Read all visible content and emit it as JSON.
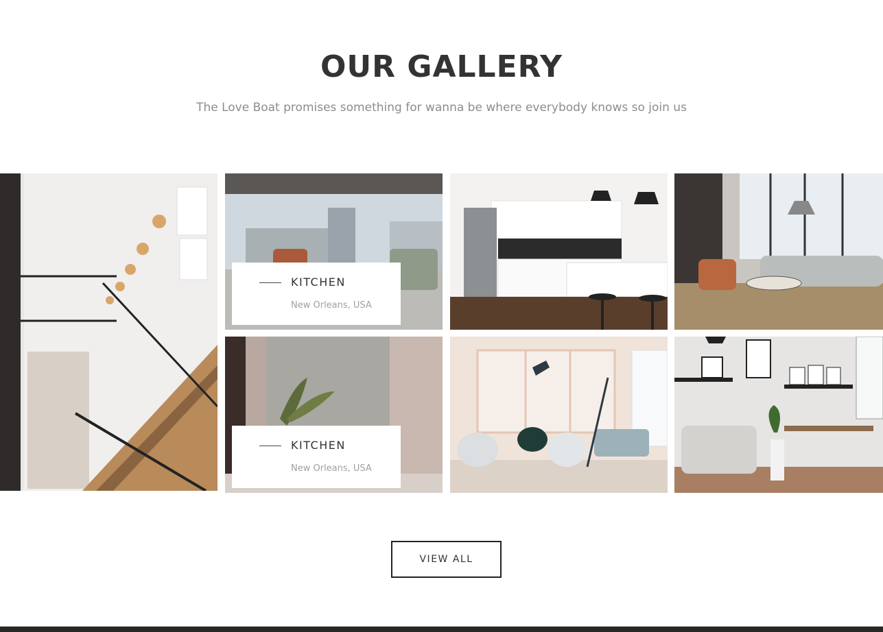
{
  "gallery": {
    "title": "OUR GALLERY",
    "subtitle": "The Love Boat promises something for wanna be where everybody knows so join us",
    "items": [
      {
        "caption": null
      },
      {
        "caption": {
          "title": "KITCHEN",
          "location": "New Orleans, USA"
        }
      },
      {
        "caption": null
      },
      {
        "caption": null
      },
      {
        "caption": {
          "title": "KITCHEN",
          "location": "New Orleans, USA"
        }
      },
      {
        "caption": null
      },
      {
        "caption": null
      }
    ],
    "view_all_label": "VIEW ALL"
  }
}
